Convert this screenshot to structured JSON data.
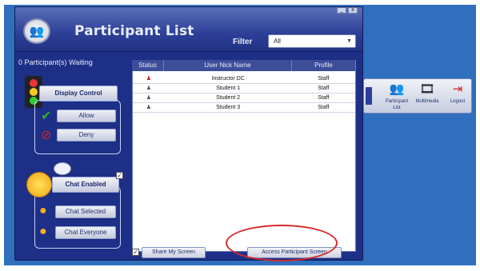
{
  "window": {
    "title": "Participant List",
    "filter_label": "Filter",
    "filter_value": "All",
    "controls": [
      "_",
      "x"
    ]
  },
  "waiting_text": "0 Participant(s) Waiting",
  "display_control": {
    "label": "Display Control",
    "allow": "Allow",
    "deny": "Deny"
  },
  "chat": {
    "enabled_label": "Chat Enabled",
    "checkbox": "✓",
    "chat_selected": "Chat Selected",
    "chat_everyone": "Chat Everyone"
  },
  "table": {
    "headers": [
      "Status",
      "User Nick Name",
      "Profile"
    ],
    "rows": [
      {
        "name": "Instructor DC",
        "profile": "Staff",
        "status": "instructor-icon"
      },
      {
        "name": "Student 1",
        "profile": "Staff",
        "status": "user-icon"
      },
      {
        "name": "Student 2",
        "profile": "Staff",
        "status": "user-icon"
      },
      {
        "name": "Student 3",
        "profile": "Staff",
        "status": "user-icon"
      }
    ]
  },
  "bottom": {
    "share_checkbox": "✓",
    "share_label": "Share My Screen",
    "access_label": "Access Participant Screen"
  },
  "toolbar": {
    "participant_list": "Participant List",
    "multimedia": "Multimedia",
    "logout": "Logout"
  },
  "colors": {
    "window_bg": "#1d2f86",
    "desktop_bg": "#2f6fbd",
    "highlight_circle": "#d62828"
  }
}
